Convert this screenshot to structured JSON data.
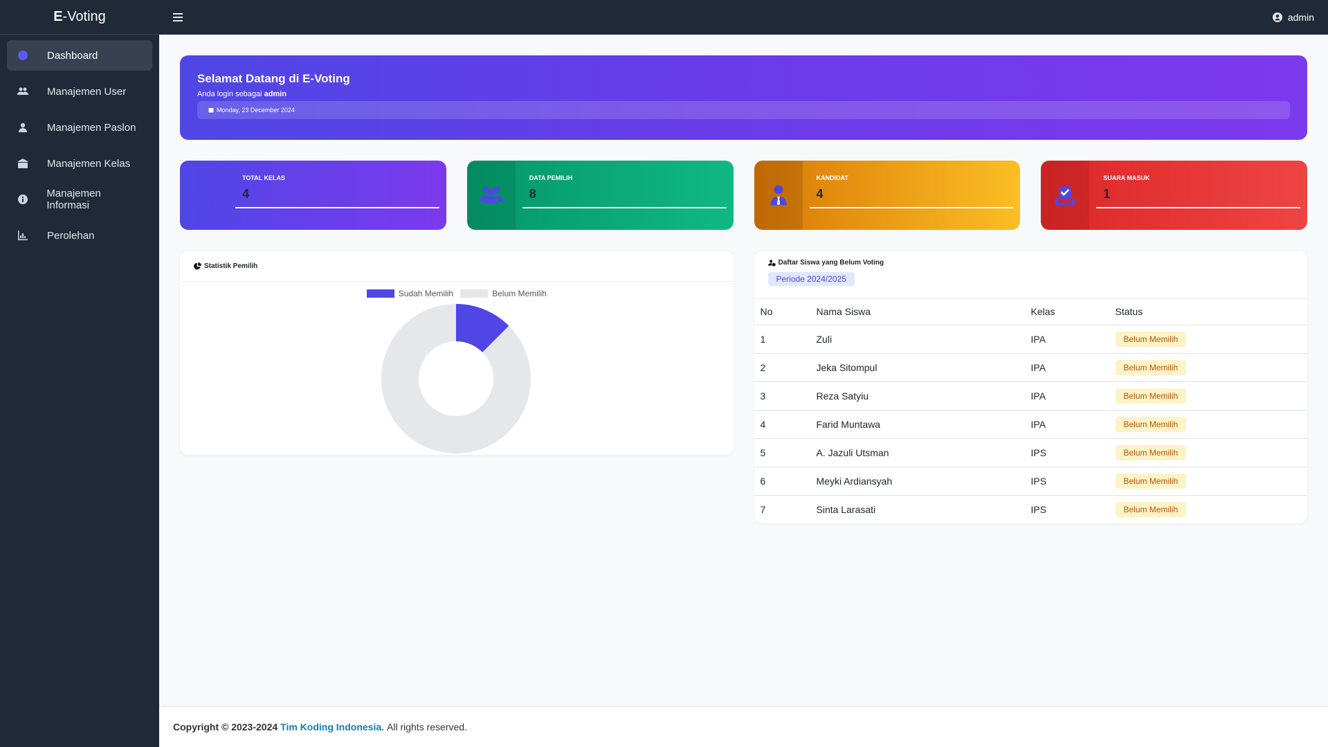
{
  "app": {
    "brand_prefix": "E",
    "brand_rest": "-Voting"
  },
  "sidebar": {
    "items": [
      {
        "label": "Dashboard",
        "icon": "info-circle-icon",
        "active": true
      },
      {
        "label": "Manajemen User",
        "icon": "users-icon"
      },
      {
        "label": "Manajemen Paslon",
        "icon": "user-icon"
      },
      {
        "label": "Manajemen Kelas",
        "icon": "school-icon"
      },
      {
        "label": "Manajemen Informasi",
        "icon": "info-circle-icon"
      },
      {
        "label": "Perolehan",
        "icon": "bar-chart-icon"
      }
    ]
  },
  "topbar": {
    "username": "admin"
  },
  "hero": {
    "title": "Selamat Datang di E-Voting",
    "login_prefix": "Anda login sebagai",
    "login_user": "admin",
    "date": "Monday, 23 December 2024"
  },
  "stats": [
    {
      "label": "TOTAL KELAS",
      "value": "4"
    },
    {
      "label": "DATA PEMILIH",
      "value": "8"
    },
    {
      "label": "KANDIDAT",
      "value": "4"
    },
    {
      "label": "SUARA MASUK",
      "value": "1"
    }
  ],
  "chart_card": {
    "title": "Statistik Pemilih"
  },
  "chart_data": {
    "type": "pie",
    "categories": [
      "Sudah Memilih",
      "Belum Memilih"
    ],
    "values": [
      1,
      7
    ],
    "colors": [
      "#4f46e5",
      "#e5e7eb"
    ],
    "donut": true,
    "legend": "top"
  },
  "table_card": {
    "title": "Daftar Siswa yang Belum Voting",
    "periode": "Periode 2024/2025",
    "columns": [
      "No",
      "Nama Siswa",
      "Kelas",
      "Status"
    ],
    "rows": [
      {
        "no": "1",
        "nama": "Zuli",
        "kelas": "IPA",
        "status": "Belum Memilih"
      },
      {
        "no": "2",
        "nama": "Jeka Sitompul",
        "kelas": "IPA",
        "status": "Belum Memilih"
      },
      {
        "no": "3",
        "nama": "Reza Satyiu",
        "kelas": "IPA",
        "status": "Belum Memilih"
      },
      {
        "no": "4",
        "nama": "Farid Muntawa",
        "kelas": "IPA",
        "status": "Belum Memilih"
      },
      {
        "no": "5",
        "nama": "A. Jazuli Utsman",
        "kelas": "IPS",
        "status": "Belum Memilih"
      },
      {
        "no": "6",
        "nama": "Meyki Ardiansyah",
        "kelas": "IPS",
        "status": "Belum Memilih"
      },
      {
        "no": "7",
        "nama": "Sinta Larasati",
        "kelas": "IPS",
        "status": "Belum Memilih"
      }
    ]
  },
  "footer": {
    "copyright": "Copyright © 2023-2024",
    "org": "Tim Koding Indonesia.",
    "rights": "All rights reserved."
  }
}
